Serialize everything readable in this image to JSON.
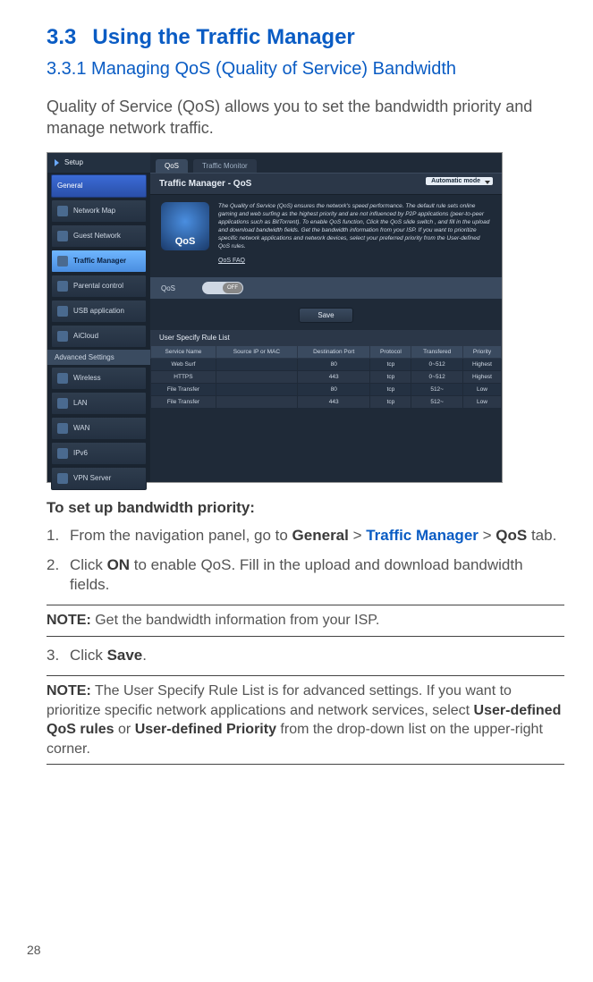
{
  "section": {
    "number": "3.3",
    "title": "Using the Traffic Manager"
  },
  "subsection": {
    "number": "3.3.1",
    "title": "Managing QoS (Quality of Service) Bandwidth"
  },
  "intro": "Quality of Service (QoS) allows you to set the bandwidth priority and manage network traffic.",
  "setup_heading": "To set up bandwidth priority:",
  "steps": {
    "s1": {
      "a": "From the navigation panel, go to ",
      "b": "General",
      "c": " > ",
      "d": "Traffic Manager",
      "e": " > ",
      "f": "QoS",
      "g": " tab."
    },
    "s2": {
      "a": "Click ",
      "b": "ON",
      "c": " to enable QoS. Fill in the upload and download bandwidth fields."
    },
    "s3": {
      "a": "Click ",
      "b": "Save",
      "c": "."
    }
  },
  "note1": {
    "label": "NOTE:",
    "text": " Get the bandwidth information from your ISP."
  },
  "note2": {
    "label": "NOTE:",
    "a": "   The User Specify Rule List is for advanced settings. If you want to prioritize specific network applications and network services, select ",
    "b": "User-defined QoS rules",
    "c": " or ",
    "d": "User-defined Priority",
    "e": " from the drop-down list on the upper-right corner."
  },
  "page_number": "28",
  "ui": {
    "sidebar": {
      "setup": "Setup",
      "general": "General",
      "items1": [
        "Network Map",
        "Guest Network",
        "Traffic Manager",
        "Parental control",
        "USB application",
        "AiCloud"
      ],
      "advanced": "Advanced Settings",
      "items2": [
        "Wireless",
        "LAN",
        "WAN",
        "IPv6",
        "VPN Server"
      ]
    },
    "tabs": {
      "qos": "QoS",
      "monitor": "Traffic Monitor"
    },
    "page_title": "Traffic Manager - QoS",
    "mode": "Automatic mode",
    "description": "The Quality of Service (QoS) ensures the network's speed performance. The default rule sets online gaming and web surfing as the highest priority and are not influenced by P2P applications (peer-to-peer applications such as BitTorrent). To enable QoS function, Click the QoS slide switch , and fill in the upload and download bandwidth fields. Get the bandwidth information from your ISP.\nIf you want to prioritize specific network applications and network devices, select your preferred priority from the User-defined QoS rules.",
    "faq": "QoS FAQ",
    "toggle": {
      "label": "QoS",
      "state": "OFF"
    },
    "save": "Save",
    "rule_header": "User Specify Rule List",
    "columns": [
      "Service Name",
      "Source IP or MAC",
      "Destination Port",
      "Protocol",
      "Transfered",
      "Priority"
    ],
    "rows": [
      {
        "c0": "Web Surf",
        "c1": "",
        "c2": "80",
        "c3": "tcp",
        "c4": "0~512",
        "c5": "Highest"
      },
      {
        "c0": "HTTPS",
        "c1": "",
        "c2": "443",
        "c3": "tcp",
        "c4": "0~512",
        "c5": "Highest"
      },
      {
        "c0": "File Transfer",
        "c1": "",
        "c2": "80",
        "c3": "tcp",
        "c4": "512~",
        "c5": "Low"
      },
      {
        "c0": "File Transfer",
        "c1": "",
        "c2": "443",
        "c3": "tcp",
        "c4": "512~",
        "c5": "Low"
      }
    ]
  }
}
